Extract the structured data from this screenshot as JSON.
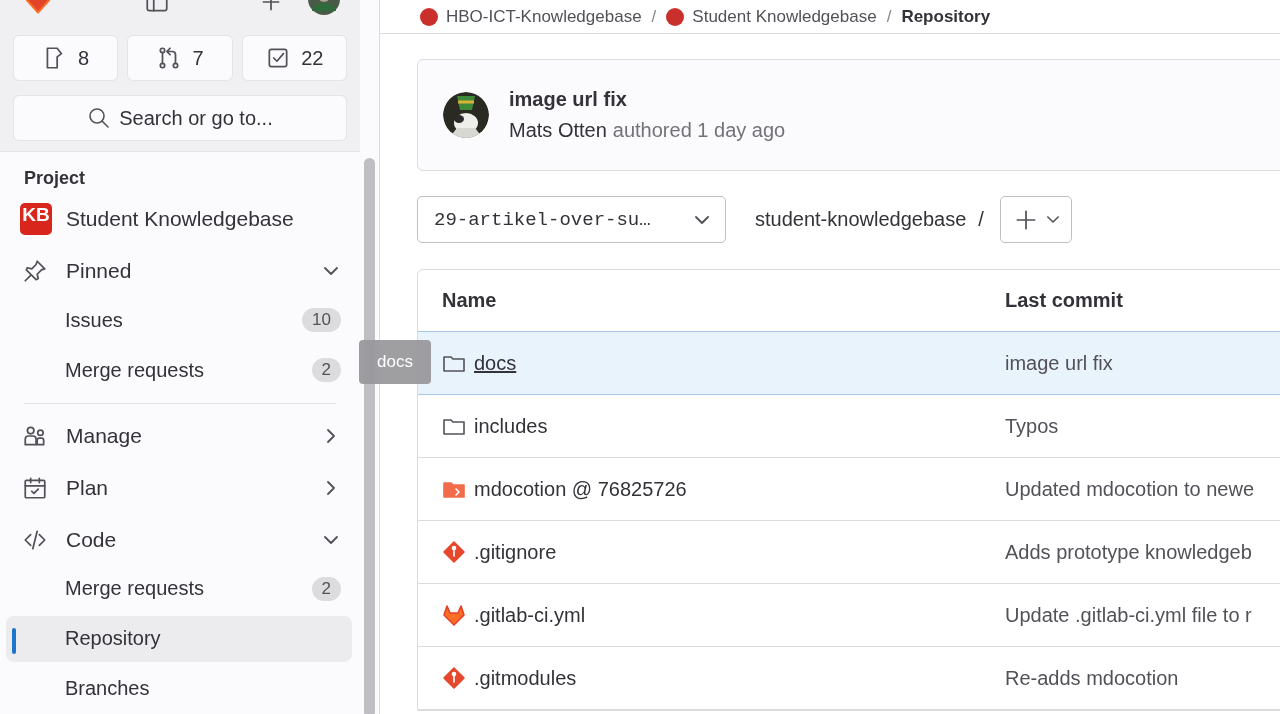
{
  "sidebar": {
    "counts": [
      {
        "kind": "issues",
        "count": "8"
      },
      {
        "kind": "merge",
        "count": "7"
      },
      {
        "kind": "todo",
        "count": "22"
      }
    ],
    "search": {
      "placeholder": "Search or go to..."
    },
    "section_title": "Project",
    "project": {
      "badge": "KB",
      "name": "Student Knowledgebase"
    },
    "items": [
      {
        "kind": "pin",
        "label": "Pinned",
        "expanded": true,
        "children": [
          {
            "label": "Issues",
            "count": "10",
            "selected": false
          },
          {
            "label": "Merge requests",
            "count": "2",
            "selected": false
          }
        ]
      },
      {
        "kind": "people",
        "label": "Manage",
        "expanded": false
      },
      {
        "kind": "calendar",
        "label": "Plan",
        "expanded": false
      },
      {
        "kind": "code",
        "label": "Code",
        "expanded": true,
        "children": [
          {
            "label": "Merge requests",
            "count": "2",
            "selected": false
          },
          {
            "label": "Repository",
            "selected": true
          },
          {
            "label": "Branches",
            "selected": false
          }
        ]
      }
    ]
  },
  "breadcrumb": [
    {
      "label": "HBO-ICT-Knowledgebase",
      "current": false
    },
    {
      "separator": "/",
      "label": "Student Knowledgebase",
      "current": false
    },
    {
      "separator": "/",
      "label": "Repository",
      "current": true
    }
  ],
  "commit": {
    "title": "image url fix",
    "author": "Mats Otten",
    "meta": "authored 1 day ago"
  },
  "repo_bar": {
    "branch": "29-artikel-over-su…",
    "path": "student-knowledgebase",
    "separator": "/"
  },
  "table": {
    "columns": [
      "Name",
      "Last commit"
    ],
    "rows": [
      {
        "kind": "folder",
        "name": "docs",
        "last_commit": "image url fix",
        "selected": true
      },
      {
        "kind": "folder",
        "name": "includes",
        "last_commit": "Typos",
        "selected": false
      },
      {
        "kind": "submodule",
        "name": "mdocotion @ 76825726",
        "last_commit": "Updated mdocotion to newe",
        "selected": false
      },
      {
        "kind": "git",
        "name": ".gitignore",
        "last_commit": "Adds prototype knowledgeb",
        "selected": false
      },
      {
        "kind": "gitlab",
        "name": ".gitlab-ci.yml",
        "last_commit": "Update .gitlab-ci.yml file to r",
        "selected": false
      },
      {
        "kind": "git",
        "name": ".gitmodules",
        "last_commit": "Re-adds mdocotion",
        "selected": false
      }
    ]
  },
  "tooltip": {
    "text": "docs"
  }
}
